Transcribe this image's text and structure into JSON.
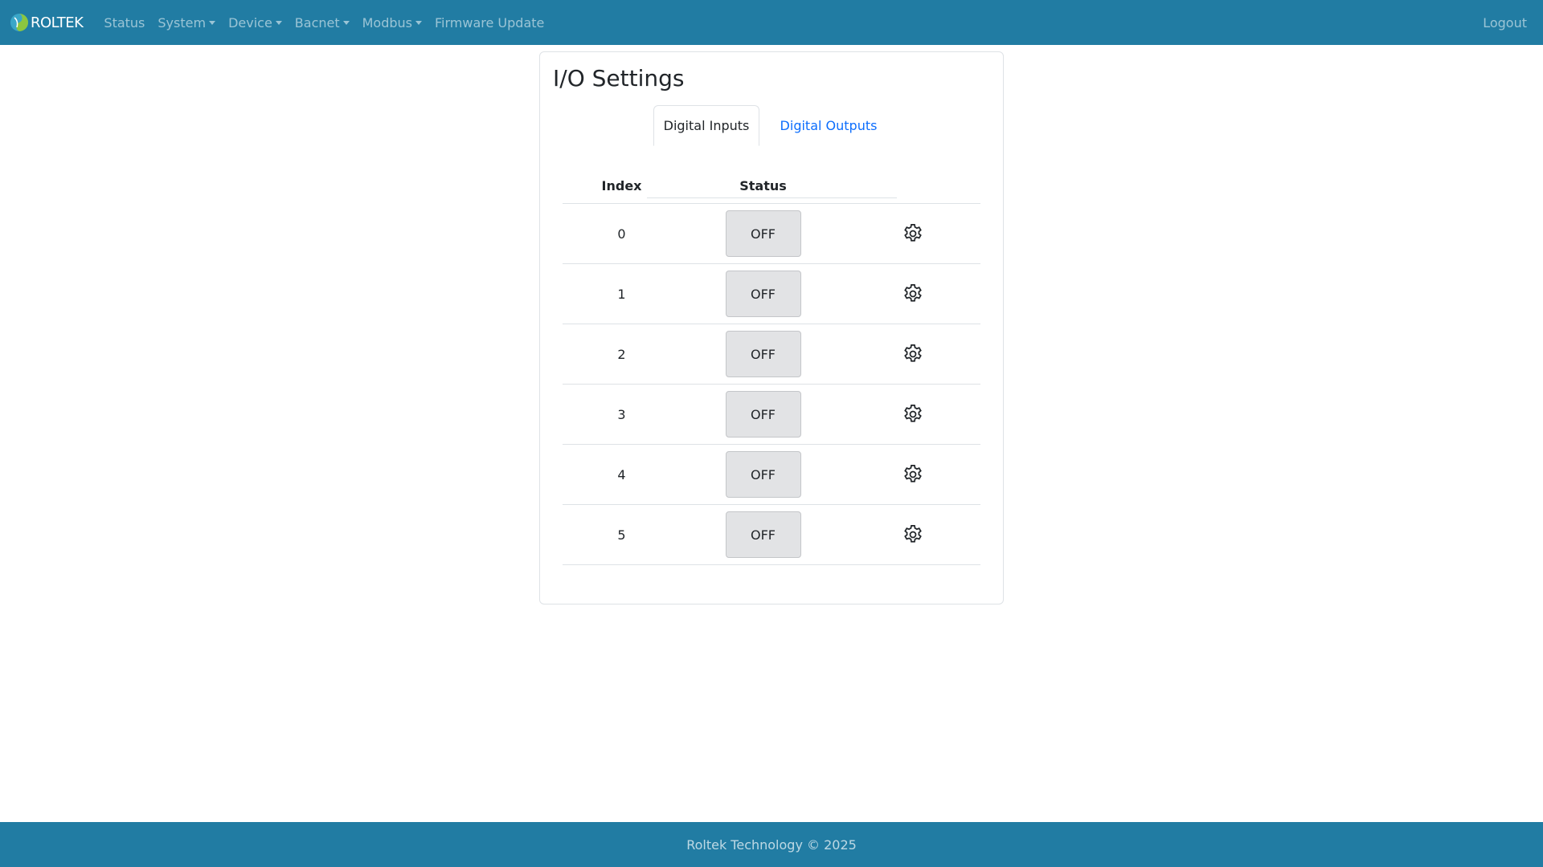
{
  "navbar": {
    "brand": "ROLTEK",
    "items": [
      {
        "label": "Status",
        "dropdown": false
      },
      {
        "label": "System",
        "dropdown": true
      },
      {
        "label": "Device",
        "dropdown": true
      },
      {
        "label": "Bacnet",
        "dropdown": true
      },
      {
        "label": "Modbus",
        "dropdown": true
      },
      {
        "label": "Firmware Update",
        "dropdown": false
      }
    ],
    "logout": "Logout"
  },
  "page": {
    "title": "I/O Settings",
    "tabs": [
      {
        "label": "Digital Inputs",
        "active": true
      },
      {
        "label": "Digital Outputs",
        "active": false
      }
    ]
  },
  "table": {
    "headers": {
      "index": "Index",
      "status": "Status"
    },
    "rows": [
      {
        "index": "0",
        "status": "OFF"
      },
      {
        "index": "1",
        "status": "OFF"
      },
      {
        "index": "2",
        "status": "OFF"
      },
      {
        "index": "3",
        "status": "OFF"
      },
      {
        "index": "4",
        "status": "OFF"
      },
      {
        "index": "5",
        "status": "OFF"
      }
    ]
  },
  "footer": {
    "text": "Roltek Technology © 2025"
  },
  "colors": {
    "navbar": "#217ca3",
    "link": "#0d6efd",
    "off_button": "#e2e3e5"
  }
}
